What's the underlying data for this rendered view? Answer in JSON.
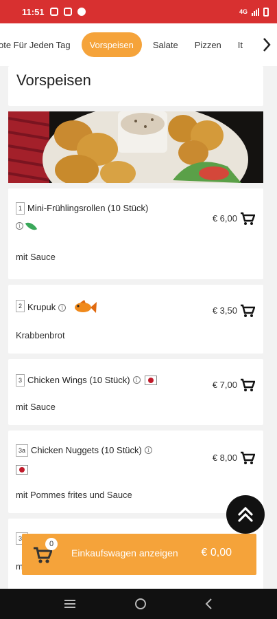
{
  "status_bar": {
    "time": "11:51",
    "network": "4G"
  },
  "tabs": {
    "items": [
      {
        "label": "ote Für Jeden Tag",
        "active": false
      },
      {
        "label": "Vorspeisen",
        "active": true
      },
      {
        "label": "Salate",
        "active": false
      },
      {
        "label": "Pizzen",
        "active": false
      },
      {
        "label": "It",
        "active": false
      }
    ]
  },
  "section": {
    "title": "Vorspeisen"
  },
  "menu": {
    "currency": "€",
    "items": [
      {
        "number": "1",
        "name": "Mini-Frühlingsrollen (10 Stück)",
        "price": "€ 6,00",
        "description": "mit Sauce",
        "badge": "vegetarian-leaf"
      },
      {
        "number": "2",
        "name": "Krupuk",
        "price": "€ 3,50",
        "description": "Krabbenbrot",
        "badge": "fish"
      },
      {
        "number": "3",
        "name": "Chicken Wings (10 Stück)",
        "price": "€ 7,00",
        "description": "mit Sauce",
        "badge": "spicy-chili"
      },
      {
        "number": "3a",
        "name": "Chicken Nuggets (10 Stück)",
        "price": "€ 8,00",
        "description": "mit Pommes frites und Sauce",
        "badge": "spicy-chili"
      },
      {
        "number": "3b",
        "name": "",
        "price": "",
        "description": "m",
        "badge": "vegetarian-leaf"
      }
    ]
  },
  "cart_bar": {
    "count": "0",
    "label": "Einkaufswagen anzeigen",
    "total": "€ 0,00"
  },
  "colors": {
    "status_bar": "#d83030",
    "accent": "#f5a33a",
    "nav_bar": "#111111"
  }
}
